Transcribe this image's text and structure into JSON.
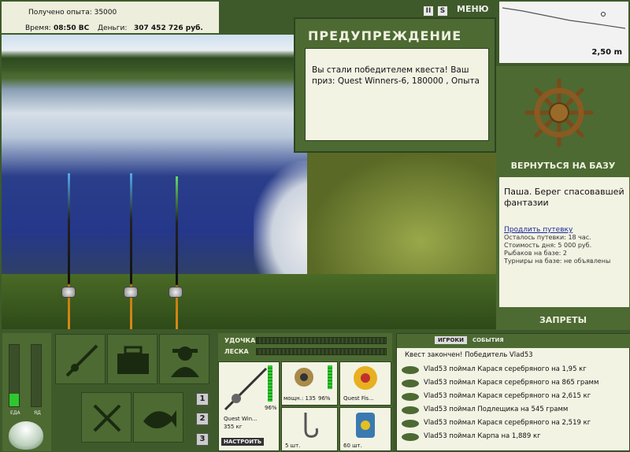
{
  "top": {
    "experience_label": "Получено опыта: 35000",
    "time_label": "Время:",
    "time_value": "08:50 ВС",
    "money_label": "Деньги:",
    "money_value": "307 452 726 руб."
  },
  "warning": {
    "title": "ПРЕДУПРЕЖДЕНИЕ",
    "message": "Вы стали победителем квеста! Ваш приз: Quest Winners-6, 180000 , Опыта"
  },
  "topbar": {
    "pause_label": "II",
    "sound_label": "S",
    "menu_label": "МЕНЮ"
  },
  "depth": {
    "value": "2,50 m"
  },
  "right_panel": {
    "return_label": "ВЕРНУТЬСЯ НА БАЗУ",
    "base_name": "Паша. Берег спасовавшей фантазии",
    "extend_link": "Продлить путевку",
    "remaining": "Осталось путевки: 18 час.",
    "cost": "Стоимость дня: 5 000 руб.",
    "fishers": "Рыбаков на базе: 2",
    "tournaments": "Турниры на базе: не объявлены",
    "bans_label": "ЗАПРЕТЫ"
  },
  "meters": {
    "food_label": "ЕДА",
    "poison_label": "ЯД",
    "food_level": 0.2,
    "poison_level": 0
  },
  "pages": [
    "1",
    "2",
    "3"
  ],
  "tackle": {
    "rod_label": "УДОЧКА",
    "line_label": "ЛЕСКА",
    "rod_name": "Quest Win...",
    "rod_weight": "355 кг",
    "rod_percent": "96%",
    "setup_label": "НАСТРОИТЬ",
    "reel_power": "мощн.: 135",
    "reel_percent": "96%",
    "line_name": "Quest Fis...",
    "hook_count": "5 шт.",
    "bait_count": "60 шт."
  },
  "events": {
    "tab_players": "ИГРОКИ",
    "tab_events": "СОБЫТИЯ",
    "header": "Квест закончен! Победитель Vlad53",
    "rows": [
      "Vlad53 поймал Карася серебряного на 1,95 кг",
      "Vlad53 поймал Карася серебряного на 865 грамм",
      "Vlad53 поймал Карася серебряного на 2,615 кг",
      "Vlad53 поймал Подлещика на 545 грамм",
      "Vlad53 поймал Карася серебряного на 2,519 кг",
      "Vlad53 поймал Карпа на 1,889 кг"
    ]
  }
}
